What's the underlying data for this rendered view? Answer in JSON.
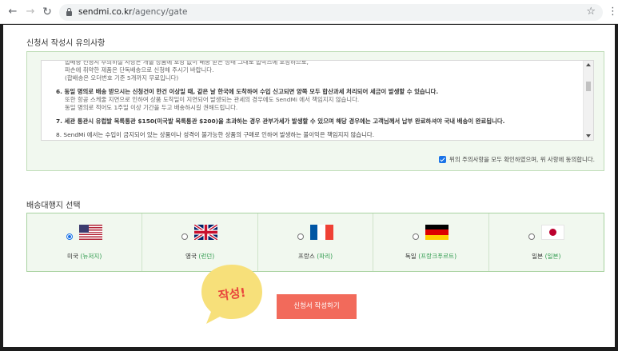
{
  "browser": {
    "url_host": "sendmi.co.kr",
    "url_path": "/agency/gate",
    "back_icon": "arrow-left-icon",
    "forward_icon": "arrow-right-icon",
    "reload_icon": "reload-icon",
    "star_icon": "star-icon"
  },
  "notes": {
    "title": "신청서 작성시 유의사항",
    "lines": [
      "합배송 신청시 주의하실 사항은 개별 상품에 포장 없이 배송 받은 상태 그대로 합박스에 포장하므로,",
      "파손에 취약한 제품은 단독배송으로 신청해 주시기 바랍니다.",
      "(합배송은 오더번호 기준 5개까지 무료입니다)",
      "6. 동일 명의로 배송 받으시는 신청건이 한건 이상일 때, 같은 날 한국에 도착하여 수입 신고되면 양쪽 모두 합산과세 처리되어 세금이 발생할 수 있습니다.",
      "또한 항공 스케줄 지연으로 인하여 상품 도착일이 지연되어 발생되는 관세의 경우에도 SendMi 에서 책임지지 않습니다.",
      "동일 명의로 적어도 1주일 이상 기간을 두고 배송하시길 권해드립니다.",
      "7. 세관 통관시 유럽발 목록통관 $150(미국발 목록통관 $200)을 초과하는 경우 관부가세가 발생할 수 있으며 해당 경우에는 고객님께서 납부 완료하셔야 국내 배송이 완료됩니다.",
      "8. SendMi 에서는 수입이 금지되어 있는 상품이나 성격이 불가능한 상품의 구매로 인하여 발생하는 불이익은 책임지지 않습니다."
    ],
    "agree_label": "위의 주의사항을 모두 확인하였으며, 위 사항에 동의합니다.",
    "agree_checked": true
  },
  "agencies": {
    "title": "배송대행지 선택",
    "items": [
      {
        "country": "미국",
        "city": "(뉴저지)",
        "flag": "us-flag-icon",
        "selected": true
      },
      {
        "country": "영국",
        "city": "(런던)",
        "flag": "uk-flag-icon",
        "selected": false
      },
      {
        "country": "프랑스",
        "city": "(파리)",
        "flag": "france-flag-icon",
        "selected": false
      },
      {
        "country": "독일",
        "city": "(프랑크푸르트)",
        "flag": "germany-flag-icon",
        "selected": false
      },
      {
        "country": "일본",
        "city": "(일본)",
        "flag": "japan-flag-icon",
        "selected": false
      }
    ]
  },
  "callout": {
    "text": "작성!",
    "bubble_color": "#f7e07a",
    "text_color": "#e8453c"
  },
  "submit": {
    "label": "신청서 작성하기",
    "color": "#f26a5b"
  },
  "colors": {
    "panel_bg": "#f1f8ef",
    "panel_border": "#a8d2a0",
    "city_text": "#2e9a4d",
    "checkbox": "#1a73e8"
  }
}
